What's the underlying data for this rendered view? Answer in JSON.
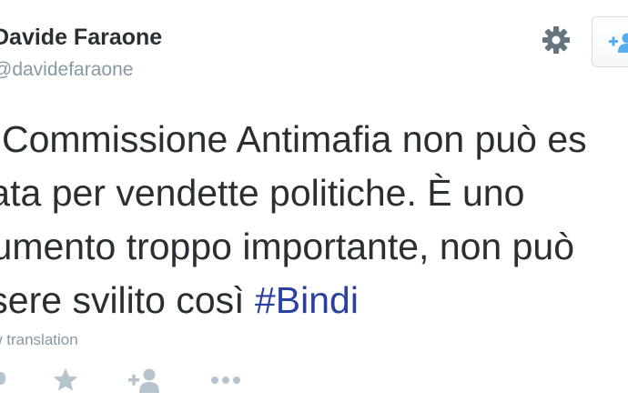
{
  "author": {
    "display_name": "Davide Faraone",
    "handle": "@davidefaraone"
  },
  "header_actions": {
    "settings_icon": "gear-icon",
    "follow_icon": "follow-user-icon"
  },
  "tweet": {
    "lines": [
      "La Commissione Antimafia non può es",
      "usata per vendette politiche. È uno",
      "strumento troppo importante, non può",
      "essere svilito così "
    ],
    "hashtag": "#Bindi"
  },
  "translation_label": "View translation",
  "actions": [
    {
      "name": "reply-icon"
    },
    {
      "name": "favorite-icon"
    },
    {
      "name": "follow-icon"
    },
    {
      "name": "more-icon"
    }
  ],
  "colors": {
    "text": "#292f33",
    "muted": "#8899a6",
    "hashtag": "#2a3fa0",
    "action_icon": "#b8c4cd",
    "follow_icon": "#55acee"
  }
}
